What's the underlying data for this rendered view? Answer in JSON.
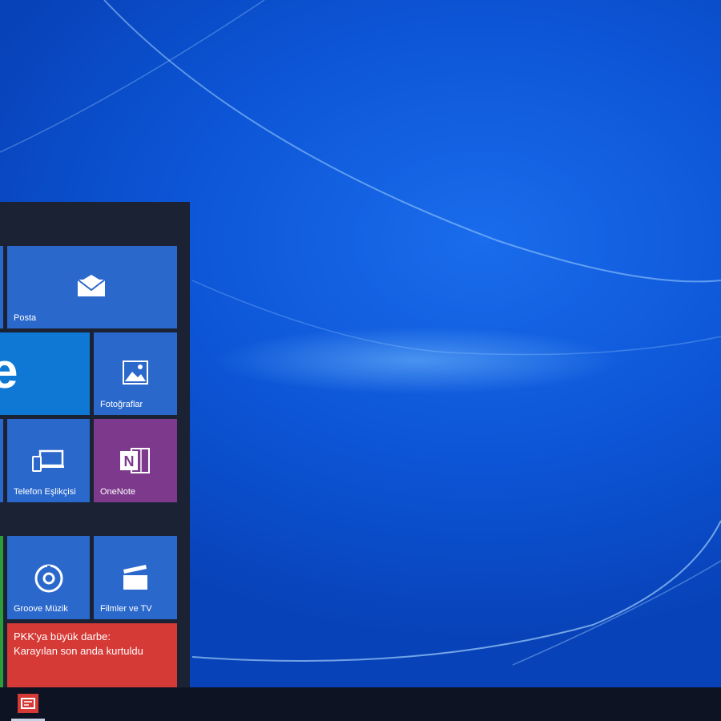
{
  "start_menu": {
    "tiles": {
      "mail": {
        "label": "Posta",
        "icon": "mail-icon",
        "color": "#2b68cc"
      },
      "edge": {
        "glyph": "e",
        "icon": "edge-icon",
        "color": "#0f78d4"
      },
      "photos": {
        "label": "Fotoğraflar",
        "icon": "photos-icon",
        "color": "#2b68cc"
      },
      "phone_companion": {
        "label": "Telefon Eşlikçisi",
        "icon": "phone-companion-icon",
        "color": "#2b68cc"
      },
      "onenote": {
        "label": "OneNote",
        "icon": "onenote-icon",
        "color": "#7d3a8c"
      },
      "groove": {
        "label": "Groove Müzik",
        "icon": "groove-music-icon",
        "color": "#2b68cc"
      },
      "movies": {
        "label": "Filmler ve TV",
        "icon": "movies-tv-icon",
        "color": "#2b68cc"
      },
      "news": {
        "headline_line1": "PKK'ya büyük darbe:",
        "headline_line2": "Karayılan son anda kurtuldu",
        "color": "#d63a36"
      }
    }
  },
  "taskbar": {
    "pinned": [
      {
        "icon": "news-app-icon",
        "color": "#d63a36"
      }
    ]
  }
}
